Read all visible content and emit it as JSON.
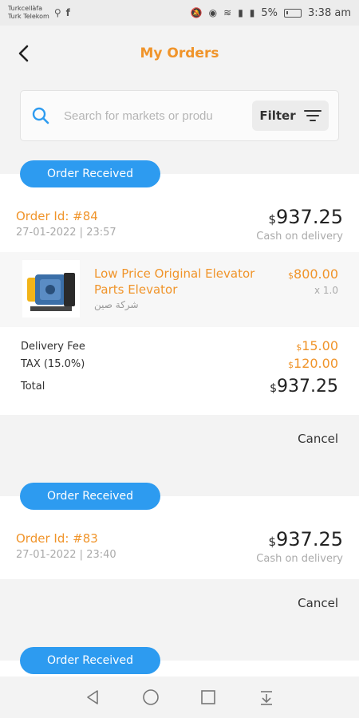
{
  "status_bar": {
    "carrier1": "Turkcellàfa",
    "carrier2": "Turk Telekom",
    "battery": "5%",
    "time": "3:38 am"
  },
  "header": {
    "title": "My Orders"
  },
  "search": {
    "placeholder": "Search for markets or produ",
    "filter_label": "Filter"
  },
  "colors": {
    "accent": "#f0942a",
    "pill": "#2d9bf0"
  },
  "orders": [
    {
      "status": "Order Received",
      "order_id": "Order Id: #84",
      "date": "27-01-2022 | 23:57",
      "currency": "$",
      "total": "937.25",
      "payment": "Cash on delivery",
      "product": {
        "name": "Low Price Original Elevator Parts Elevator",
        "shop": "شركة صين",
        "price": "800.00",
        "qty": "x 1.0"
      },
      "delivery_fee_label": "Delivery Fee",
      "delivery_fee": "15.00",
      "tax_label": "TAX (15.0%)",
      "tax": "120.00",
      "total_label": "Total",
      "grand_total": "937.25",
      "cancel_label": "Cancel"
    },
    {
      "status": "Order Received",
      "order_id": "Order Id: #83",
      "date": "27-01-2022 | 23:40",
      "currency": "$",
      "total": "937.25",
      "payment": "Cash on delivery",
      "cancel_label": "Cancel"
    },
    {
      "status": "Order Received"
    }
  ]
}
